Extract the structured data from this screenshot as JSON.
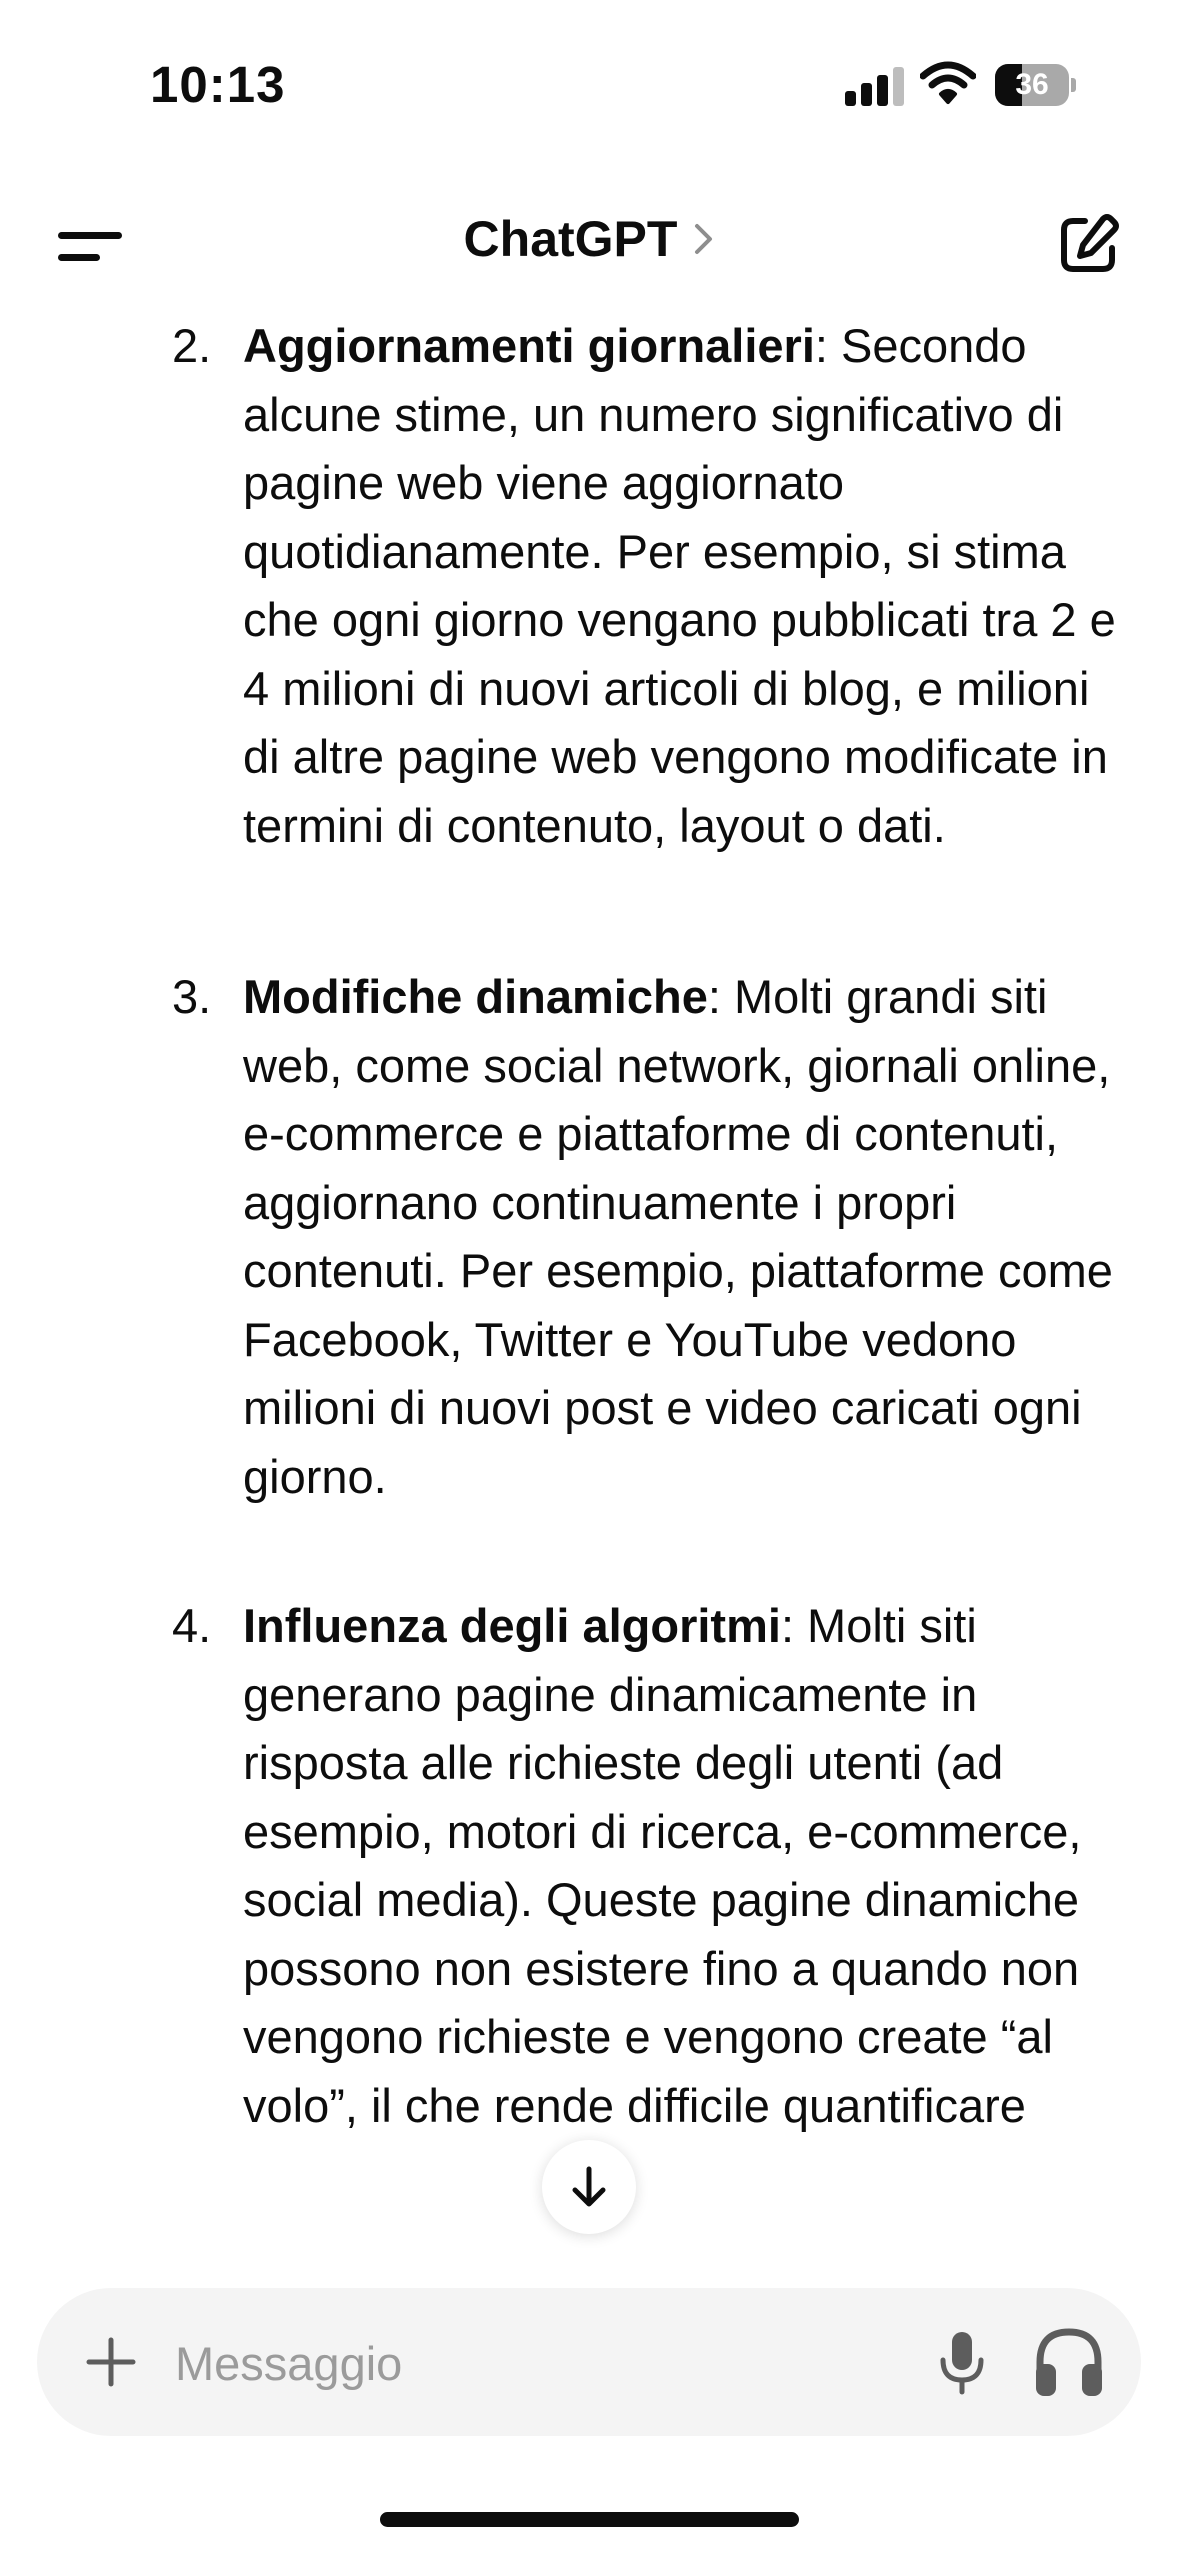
{
  "status_bar": {
    "time": "10:13",
    "battery_percent": 36,
    "battery_label": "36",
    "icons": [
      "cellular-signal-icon",
      "wifi-icon",
      "battery-icon"
    ]
  },
  "header": {
    "title": "ChatGPT",
    "icons": [
      "menu-icon",
      "chevron-right-icon",
      "new-chat-icon"
    ]
  },
  "message": {
    "items": [
      {
        "number": "2.",
        "lead": "Aggiornamenti giornalieri",
        "text": ": Secondo alcune stime, un numero significativo di pagine web viene aggiornato quotidianamente. Per esempio, si stima che ogni giorno vengano pubblicati tra 2 e 4 milioni di nuovi articoli di blog, e milioni di altre pagine web vengono modificate in termini di contenuto, layout o dati."
      },
      {
        "number": "3.",
        "lead": "Modifiche dinamiche",
        "text": ": Molti grandi siti web, come social network, giornali online, e-commerce e piattaforme di contenuti, aggiornano continuamente i propri contenuti. Per esempio, piattaforme come Facebook, Twitter e YouTube vedono milioni di nuovi post e video caricati ogni giorno."
      },
      {
        "number": "4.",
        "lead": "Influenza degli algoritmi",
        "text": ": Molti siti generano pagine dinamicamente in risposta alle richieste degli utenti (ad esempio, motori di ricerca, e-commerce, social media). Queste pagine dinamiche possono non esistere fino a quando non vengono richieste e vengono create “al volo”, il che rende difficile quantificare"
      }
    ]
  },
  "composer": {
    "placeholder": "Messaggio",
    "icons": [
      "plus-icon",
      "microphone-icon",
      "headphones-icon",
      "arrow-down-icon"
    ]
  }
}
